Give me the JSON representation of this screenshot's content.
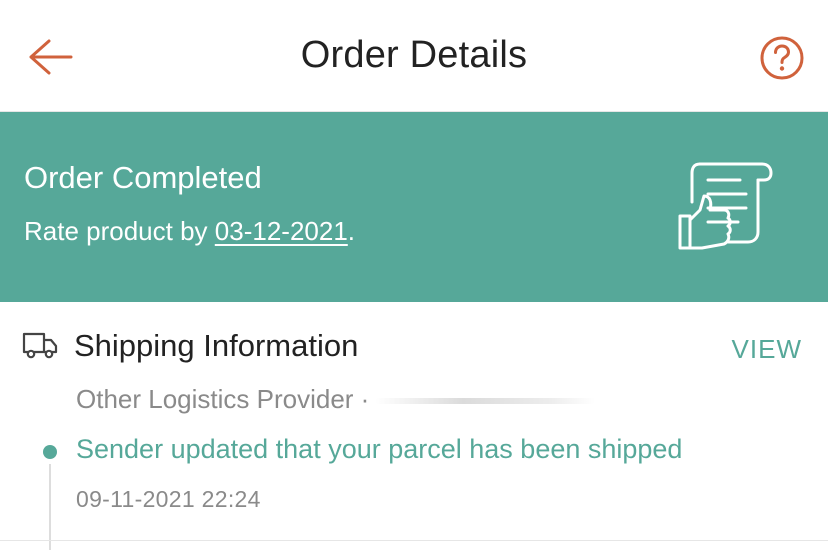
{
  "colors": {
    "accent": "#56a899",
    "banner_bg": "#56a899",
    "header_icons": "#d0623c"
  },
  "header": {
    "title": "Order Details",
    "back_icon": "arrow-left-icon",
    "help_icon": "question-circle-icon"
  },
  "status_banner": {
    "title": "Order Completed",
    "rate_prefix": "Rate product by ",
    "rate_date": "03-12-2021",
    "rate_suffix": ".",
    "icon": "receipt-thumbs-up-icon"
  },
  "shipping": {
    "icon": "truck-icon",
    "title": "Shipping Information",
    "view_label": "VIEW",
    "provider": "Other Logistics Provider ·",
    "events": [
      {
        "text": "Sender updated that your parcel has been shipped",
        "time": "09-11-2021 22:24"
      }
    ]
  }
}
